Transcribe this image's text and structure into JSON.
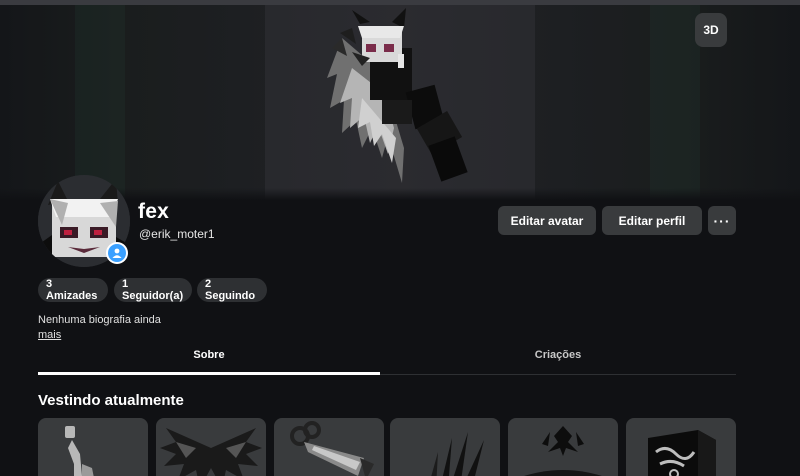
{
  "hero": {
    "view_3d_label": "3D"
  },
  "profile": {
    "display_name": "fex",
    "username": "@erik_moter1",
    "bio": "Nenhuma biografia ainda",
    "more_link": "mais"
  },
  "actions": {
    "edit_avatar": "Editar avatar",
    "edit_profile": "Editar perfil",
    "more": "···"
  },
  "stats": {
    "friends": "3 Amizades",
    "followers": "1 Seguidor(a)",
    "following": "2 Seguindo"
  },
  "tabs": [
    {
      "label": "Sobre",
      "active": true
    },
    {
      "label": "Criações",
      "active": false
    }
  ],
  "wearing": {
    "title": "Vestindo atualmente",
    "items": [
      {
        "icon": "torso-figure-icon"
      },
      {
        "icon": "dark-wings-icon"
      },
      {
        "icon": "chain-claw-icon"
      },
      {
        "icon": "feather-wings-icon"
      },
      {
        "icon": "tribal-mask-icon"
      },
      {
        "icon": "graffiti-box-icon"
      }
    ]
  },
  "colors": {
    "background": "#101114",
    "button": "#393b3d",
    "pill": "#2e3033",
    "verified": "#3aa0ff"
  }
}
